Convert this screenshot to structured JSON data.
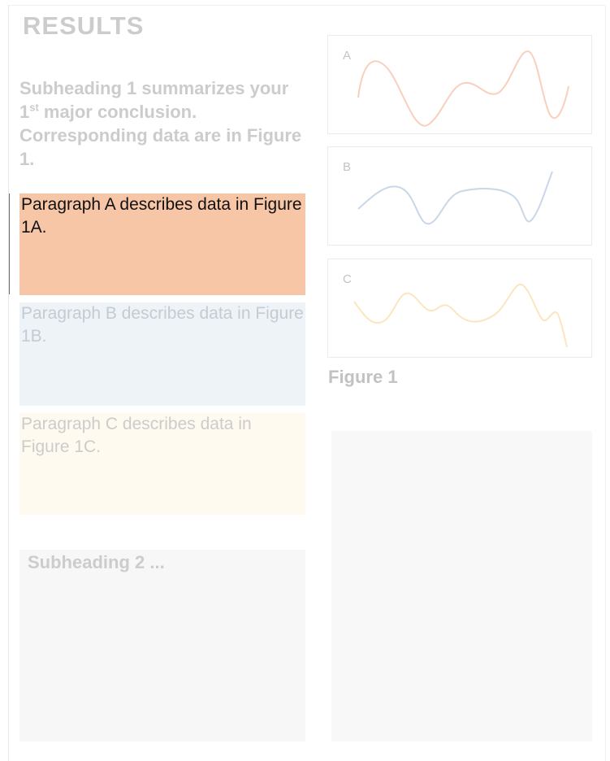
{
  "section_title": "RESULTS",
  "subheading1": {
    "before": "Subheading 1 summarizes your 1",
    "sup": "st",
    "after": " major conclusion. Corresponding data are in Figure 1."
  },
  "paragraphs": {
    "a": "Paragraph A describes data in Figure 1A.",
    "b": "Paragraph B describes data in Figure 1B.",
    "c": "Paragraph C describes data in Figure 1C."
  },
  "subheading2": "Subheading 2 ...",
  "figure": {
    "caption": "Figure 1",
    "panels": [
      {
        "label": "A",
        "color": "#f9cfbd"
      },
      {
        "label": "B",
        "color": "#c9d7e8"
      },
      {
        "label": "C",
        "color": "#fbe6bf"
      }
    ]
  },
  "colors": {
    "highlight_a": "#f7c6a7",
    "highlight_b": "#eef3f8",
    "highlight_c": "#fffaf0",
    "muted_text": "#cccccc"
  }
}
